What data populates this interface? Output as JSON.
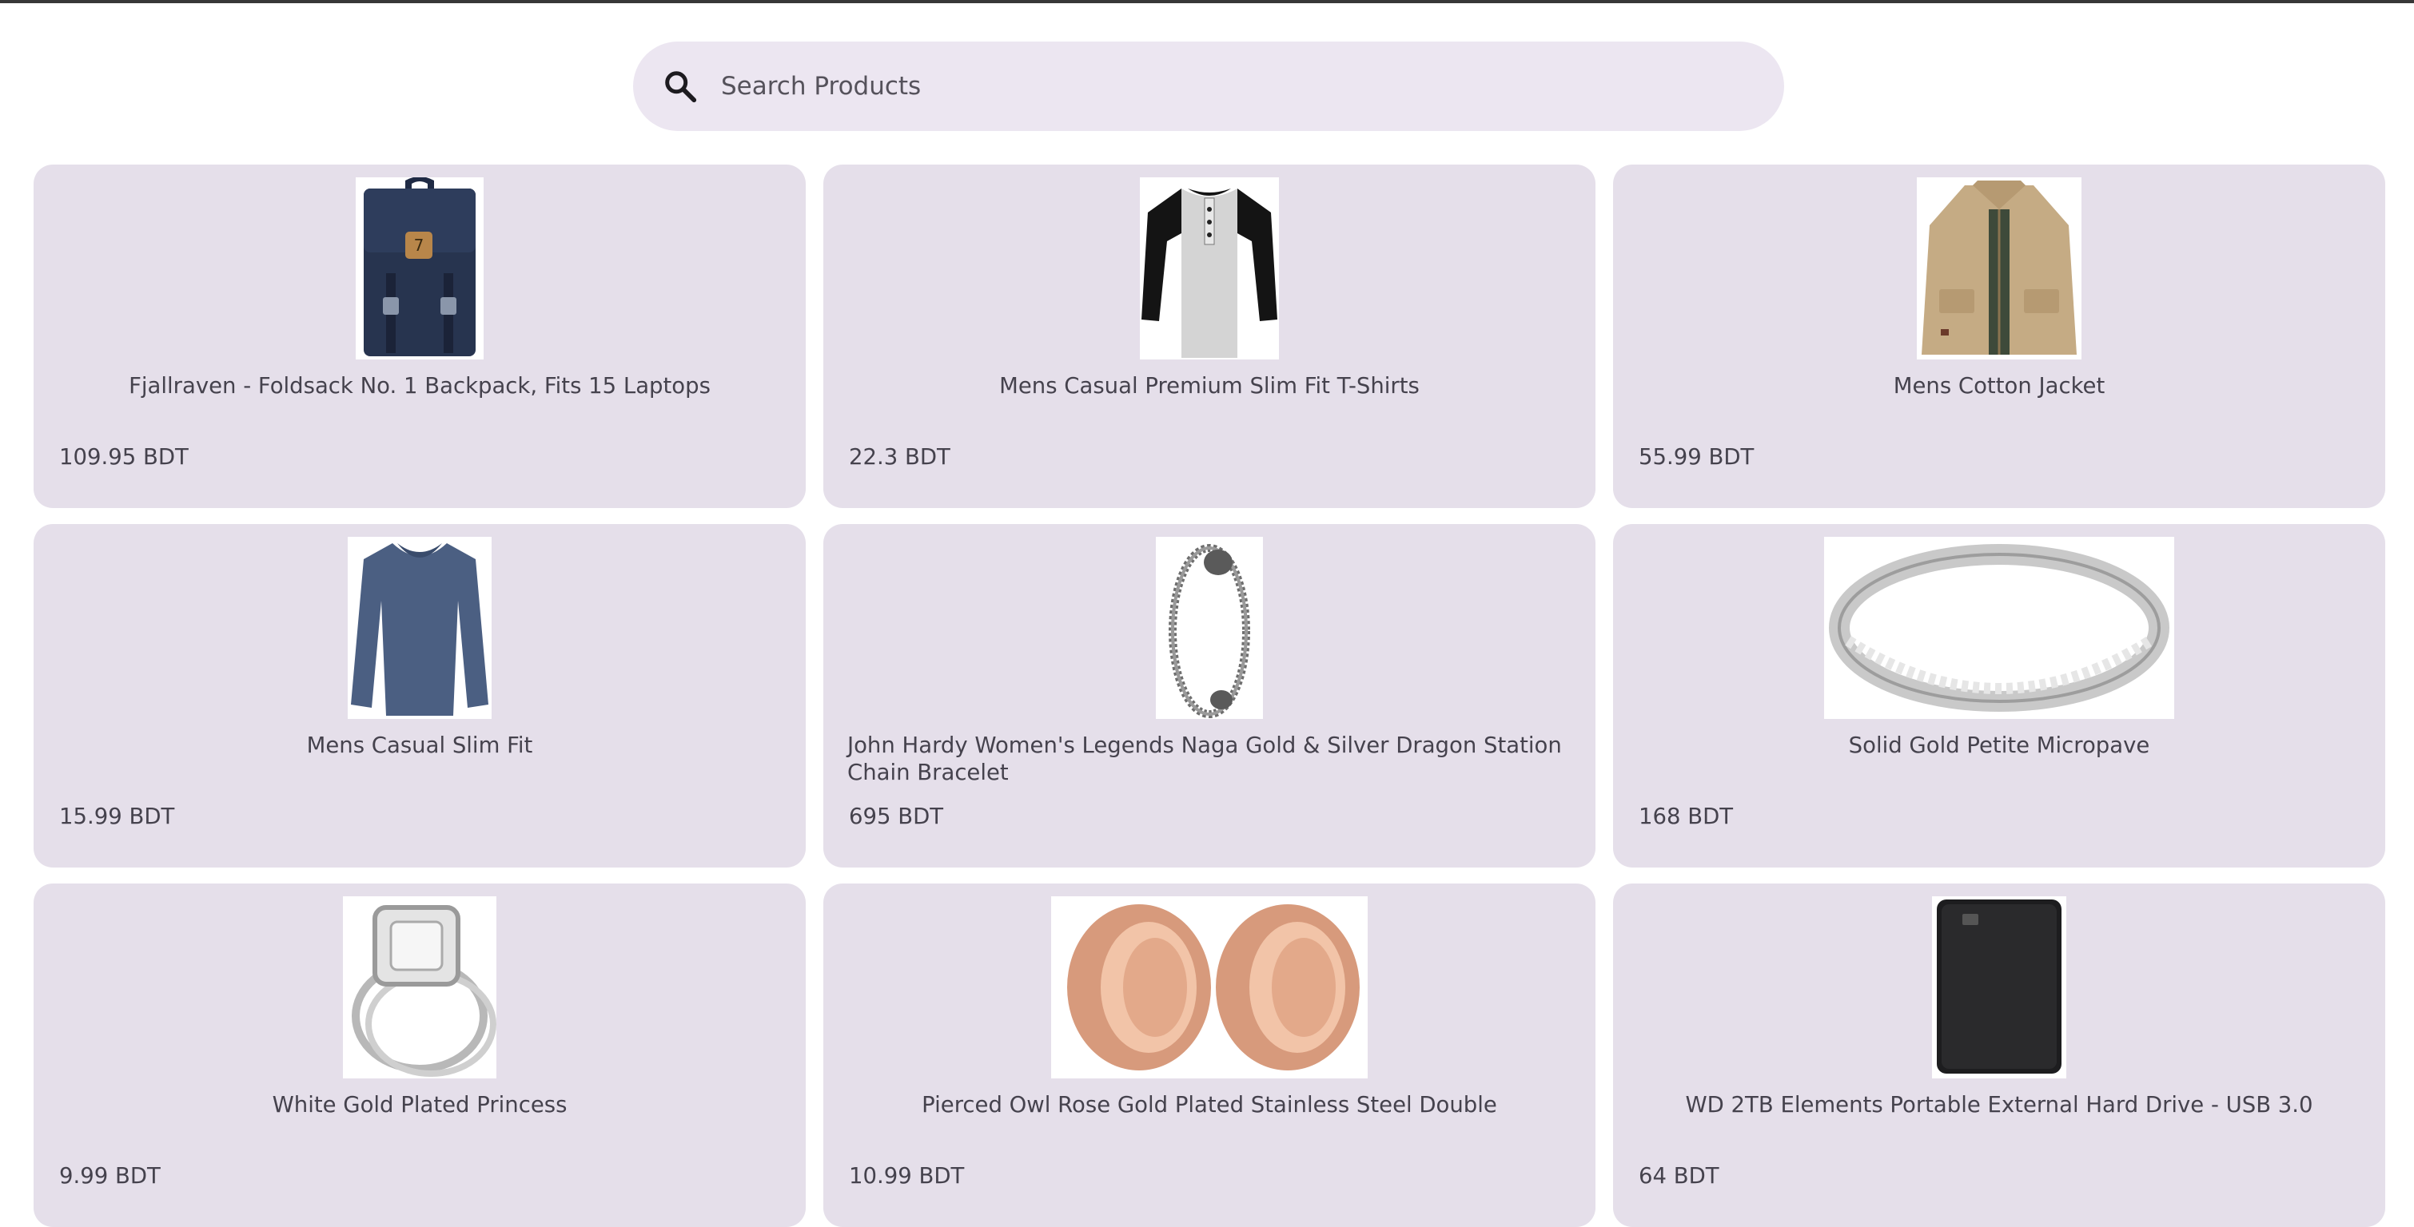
{
  "search": {
    "placeholder": "Search Products",
    "icon": "search-icon"
  },
  "products": [
    {
      "name": "Fjallraven - Foldsack No. 1 Backpack, Fits 15 Laptops",
      "price": "109.95 BDT",
      "image": "backpack"
    },
    {
      "name": "Mens Casual Premium Slim Fit T-Shirts",
      "price": "22.3 BDT",
      "image": "raglan-tshirt"
    },
    {
      "name": "Mens Cotton Jacket",
      "price": "55.99 BDT",
      "image": "cotton-jacket"
    },
    {
      "name": "Mens Casual Slim Fit",
      "price": "15.99 BDT",
      "image": "long-sleeve-shirt"
    },
    {
      "name": "John Hardy Women's Legends Naga Gold & Silver Dragon Station Chain Bracelet",
      "price": "695 BDT",
      "image": "dragon-bracelet"
    },
    {
      "name": "Solid Gold Petite Micropave",
      "price": "168 BDT",
      "image": "micropave-ring"
    },
    {
      "name": "White Gold Plated Princess",
      "price": "9.99 BDT",
      "image": "princess-ring-set"
    },
    {
      "name": "Pierced Owl Rose Gold Plated Stainless Steel Double",
      "price": "10.99 BDT",
      "image": "rose-gold-plugs"
    },
    {
      "name": "WD 2TB Elements Portable External Hard Drive - USB 3.0",
      "price": "64 BDT",
      "image": "external-hard-drive"
    }
  ],
  "colors": {
    "card_background": "#e5dfea",
    "search_background": "#ece6f1",
    "text": "#45424d"
  }
}
